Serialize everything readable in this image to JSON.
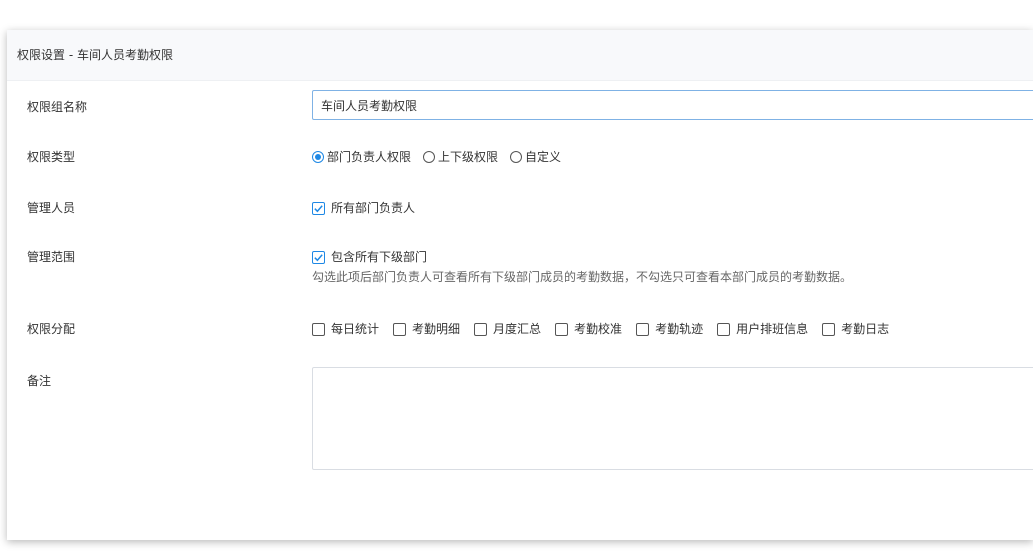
{
  "header": {
    "title": "权限设置 - 车间人员考勤权限"
  },
  "form": {
    "group_name": {
      "label": "权限组名称",
      "value": "车间人员考勤权限"
    },
    "perm_type": {
      "label": "权限类型",
      "options": [
        "部门负责人权限",
        "上下级权限",
        "自定义"
      ],
      "selected": "部门负责人权限"
    },
    "managers": {
      "label": "管理人员",
      "checkbox_label": "所有部门负责人",
      "checked": true
    },
    "scope": {
      "label": "管理范围",
      "checkbox_label": "包含所有下级部门",
      "checked": true,
      "hint": "勾选此项后部门负责人可查看所有下级部门成员的考勤数据，不勾选只可查看本部门成员的考勤数据。"
    },
    "allocation": {
      "label": "权限分配",
      "options": [
        "每日统计",
        "考勤明细",
        "月度汇总",
        "考勤校准",
        "考勤轨迹",
        "用户排班信息",
        "考勤日志"
      ]
    },
    "remark": {
      "label": "备注",
      "value": ""
    }
  },
  "colors": {
    "accent": "#1e88e5",
    "input_border_focus": "#7fb2e5",
    "header_bg": "#f8f9fb"
  }
}
